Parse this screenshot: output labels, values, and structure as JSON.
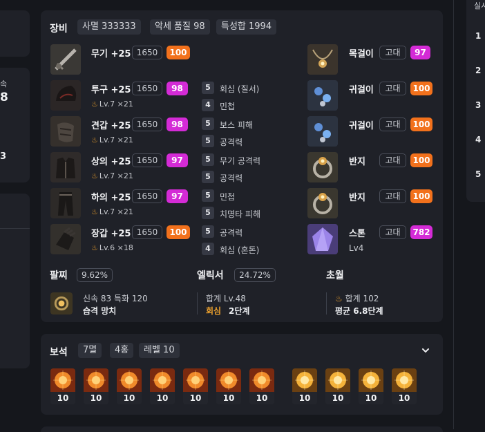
{
  "left_fragments": {
    "a": "속",
    "b": "8",
    "c": "3"
  },
  "right_rail": {
    "head": "실시",
    "ranks": [
      "1",
      "2",
      "3",
      "4",
      "5"
    ]
  },
  "equip": {
    "title": "장비",
    "tags": [
      "사멸 333333",
      "악세 품질 98",
      "특성합 1994"
    ],
    "items": [
      {
        "name": "무기 +25",
        "ilvl": "1650",
        "q": "100",
        "qc": "o",
        "icon": "weapon-icon"
      },
      {
        "name": "투구 +25",
        "ilvl": "1650",
        "q": "98",
        "qc": "m",
        "lv": "Lv.7",
        "cnt": "×21",
        "icon": "helmet-icon"
      },
      {
        "name": "견갑 +25",
        "ilvl": "1650",
        "q": "98",
        "qc": "m",
        "lv": "Lv.7",
        "cnt": "×21",
        "icon": "shoulder-icon"
      },
      {
        "name": "상의 +25",
        "ilvl": "1650",
        "q": "97",
        "qc": "m",
        "lv": "Lv.7",
        "cnt": "×21",
        "icon": "chest-icon"
      },
      {
        "name": "하의 +25",
        "ilvl": "1650",
        "q": "97",
        "qc": "m",
        "lv": "Lv.7",
        "cnt": "×21",
        "icon": "pants-icon"
      },
      {
        "name": "장갑 +25",
        "ilvl": "1650",
        "q": "100",
        "qc": "o",
        "lv": "Lv.6",
        "cnt": "×18",
        "icon": "gloves-icon"
      }
    ],
    "effects": [
      {
        "n": "5",
        "t": "회심 (질서)"
      },
      {
        "n": "4",
        "t": "민첩"
      },
      {
        "n": "5",
        "t": "보스 피해"
      },
      {
        "n": "5",
        "t": "공격력"
      },
      {
        "n": "5",
        "t": "무기 공격력"
      },
      {
        "n": "5",
        "t": "공격력"
      },
      {
        "n": "5",
        "t": "민첩"
      },
      {
        "n": "5",
        "t": "치명타 피해"
      },
      {
        "n": "5",
        "t": "공격력"
      },
      {
        "n": "4",
        "t": "회심 (혼돈)"
      }
    ],
    "accessories": [
      {
        "name": "목걸이",
        "grade": "고대",
        "q": "97",
        "qc": "m",
        "icon": "necklace-icon"
      },
      {
        "name": "귀걸이",
        "grade": "고대",
        "q": "100",
        "qc": "o",
        "icon": "earring-icon"
      },
      {
        "name": "귀걸이",
        "grade": "고대",
        "q": "100",
        "qc": "o",
        "icon": "earring-icon"
      },
      {
        "name": "반지",
        "grade": "고대",
        "q": "100",
        "qc": "o",
        "icon": "ring-icon"
      },
      {
        "name": "반지",
        "grade": "고대",
        "q": "100",
        "qc": "o",
        "icon": "ring-icon"
      },
      {
        "name": "스톤",
        "grade": "고대",
        "q": "782",
        "qc": "m",
        "lv": "Lv4",
        "icon": "stone-icon"
      }
    ],
    "bracelet": {
      "title": "팔찌",
      "pct": "9.62%",
      "stats": "신속 83  특화 120",
      "effects": "습격  망치"
    },
    "elixir": {
      "title": "엘릭서",
      "pct": "24.72%",
      "total": "합계 Lv.48",
      "hl": "회심",
      "stage": "2단계"
    },
    "transcend": {
      "title": "초월",
      "total": "합계 102",
      "avg": "평균 6.8단계"
    }
  },
  "gems": {
    "title": "보석",
    "tags": [
      "7멸",
      "4홍",
      "레벨 10"
    ],
    "items": [
      {
        "v": "10",
        "kind": "멸"
      },
      {
        "v": "10",
        "kind": "멸"
      },
      {
        "v": "10",
        "kind": "멸"
      },
      {
        "v": "10",
        "kind": "멸"
      },
      {
        "v": "10",
        "kind": "멸"
      },
      {
        "v": "10",
        "kind": "멸"
      },
      {
        "v": "10",
        "kind": "멸"
      },
      {
        "v": "10",
        "kind": "홍"
      },
      {
        "v": "10",
        "kind": "홍"
      },
      {
        "v": "10",
        "kind": "홍"
      },
      {
        "v": "10",
        "kind": "홍"
      }
    ]
  },
  "colors": {
    "orange": "#f2711c",
    "magenta": "#d42bd6",
    "panel": "#1f2128",
    "bg": "#15171c"
  }
}
